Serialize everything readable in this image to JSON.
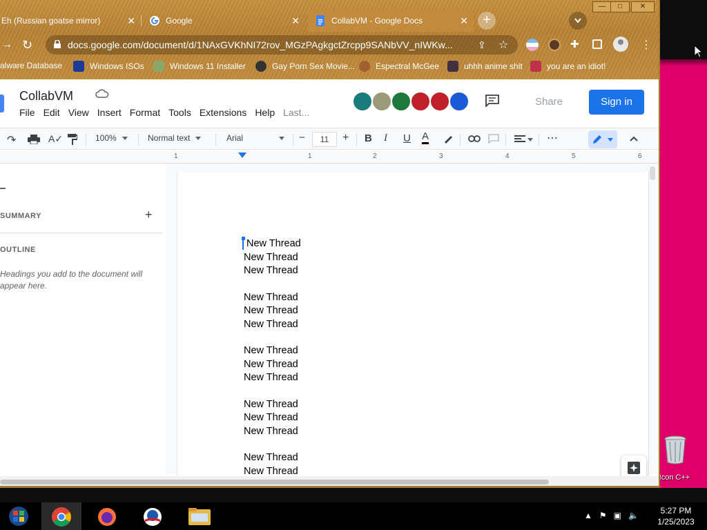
{
  "browser": {
    "tabs": [
      {
        "title": "Eh (Russian goatse mirror)",
        "active": false
      },
      {
        "title": "Google",
        "active": false
      },
      {
        "title": "CollabVM - Google Docs",
        "active": true
      }
    ],
    "close_glyph": "✕",
    "new_tab_glyph": "+",
    "url": "docs.google.com/document/d/1NAxGVKhNI72rov_MGzPAgkgctZrcpp9SANbVV_nIWKw...",
    "bookmarks": [
      {
        "label": "alware Database"
      },
      {
        "label": "Windows ISOs"
      },
      {
        "label": "Windows 11 Installer"
      },
      {
        "label": "Gay Porn Sex Movie..."
      },
      {
        "label": "Espectral McGee"
      },
      {
        "label": "uhhh anime shit"
      },
      {
        "label": "you are an idiot!"
      }
    ],
    "window_buttons": {
      "min": "—",
      "max": "□",
      "close": "✕"
    }
  },
  "docs": {
    "title": "CollabVM",
    "menu": [
      "File",
      "Edit",
      "View",
      "Insert",
      "Format",
      "Tools",
      "Extensions",
      "Help"
    ],
    "last_edit": "Last...",
    "share_label": "Share",
    "signin_label": "Sign in",
    "toolbar": {
      "zoom": "100%",
      "style": "Normal text",
      "font": "Arial",
      "font_size": "11",
      "minus": "−",
      "plus": "+",
      "bold": "B",
      "italic": "I",
      "underline": "U",
      "text_color": "A",
      "more": "⋯"
    },
    "ruler": [
      "1",
      "1",
      "2",
      "3",
      "4",
      "5",
      "6"
    ],
    "outline": {
      "summary": "SUMMARY",
      "outline": "OUTLINE",
      "hint": "Headings you add to the document will appear here."
    },
    "body_lines": [
      "New Thread",
      "New Thread",
      "New Thread",
      "",
      "New Thread",
      "New Thread",
      "New Thread",
      "",
      "New Thread",
      "New Thread",
      "New Thread",
      "",
      "New Thread",
      "New Thread",
      "New Thread",
      "",
      "New Thread",
      "New Thread"
    ],
    "colors": {
      "accent": "#1a73e8",
      "share_text": "#9aa0a6"
    }
  },
  "desktop": {
    "recycle_label": "Icon C++",
    "clock_time": "5:27 PM",
    "clock_date": "1/25/2023"
  }
}
